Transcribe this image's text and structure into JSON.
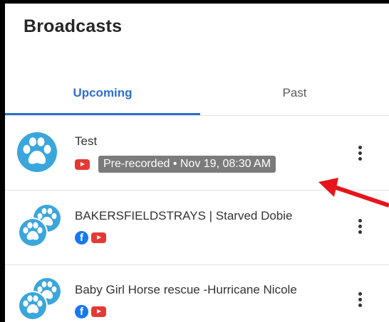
{
  "header": {
    "title": "Broadcasts"
  },
  "tabs": [
    {
      "label": "Upcoming",
      "active": true
    },
    {
      "label": "Past",
      "active": false
    }
  ],
  "broadcasts": [
    {
      "name": "Test",
      "platforms": [
        "youtube"
      ],
      "status": "Pre-recorded • Nov 19, 08:30 AM",
      "avatar_icon": "paw-print-icon"
    },
    {
      "name": "BAKERSFIELDSTRAYS | Starved Dobie",
      "platforms": [
        "facebook",
        "youtube"
      ],
      "avatar_icon": "paw-prints-icon"
    },
    {
      "name": "Baby Girl Horse rescue -Hurricane Nicole",
      "platforms": [
        "facebook",
        "youtube"
      ],
      "avatar_icon": "paw-prints-icon"
    }
  ],
  "icons": {
    "more": "more-vertical-icon",
    "youtube": "youtube-icon",
    "facebook": "facebook-icon",
    "annotation": "red-arrow"
  },
  "colors": {
    "accent": "#2e6fd1",
    "avatar": "#3aa6dc",
    "youtube": "#e53935",
    "facebook": "#1877f2",
    "badge": "#7b7b7b",
    "arrow": "#e8141b"
  }
}
